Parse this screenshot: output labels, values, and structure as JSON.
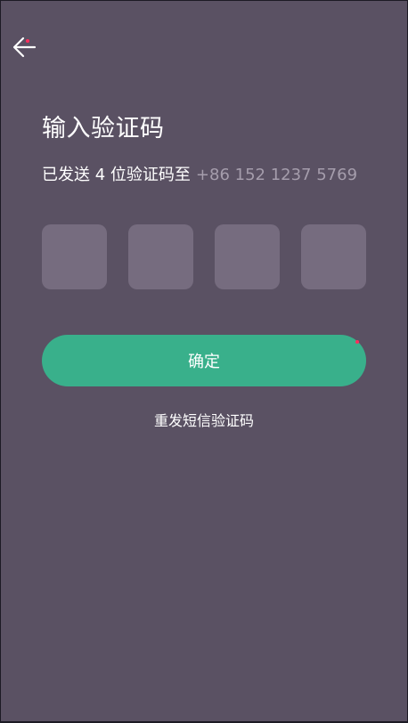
{
  "header": {
    "back_icon": "arrow-left-icon"
  },
  "title": "输入验证码",
  "subtitle": {
    "text": "已发送 4 位验证码至",
    "phone": "+86 152 1237 5769"
  },
  "code_boxes": [
    "",
    "",
    "",
    ""
  ],
  "actions": {
    "confirm_label": "确定",
    "resend_label": "重发短信验证码"
  },
  "colors": {
    "background": "#5a5163",
    "input_box": "#766c7f",
    "primary": "#39b08b",
    "phone_text": "#a59dac",
    "indicator_dot": "#ff2f5c"
  }
}
